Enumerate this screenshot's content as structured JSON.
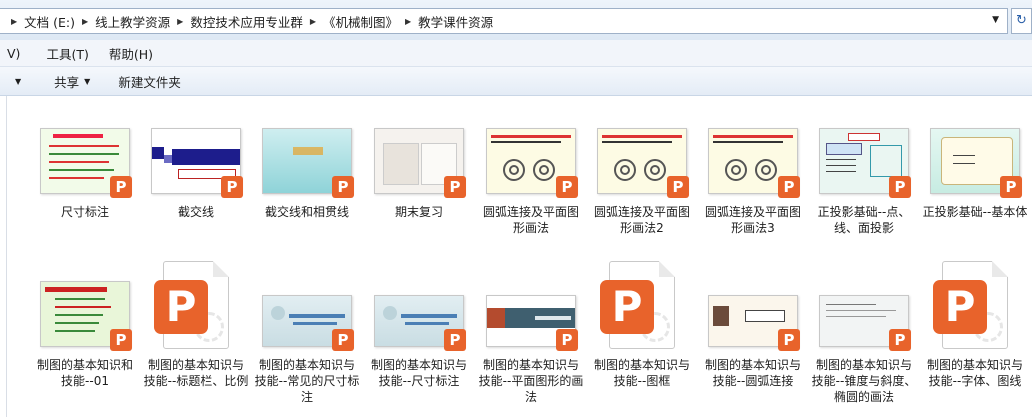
{
  "breadcrumb": {
    "items": [
      "文档 (E:)",
      "线上教学资源",
      "数控技术应用专业群",
      "《机械制图》",
      "教学课件资源"
    ]
  },
  "menubar": {
    "items": [
      "V)",
      "工具(T)",
      "帮助(H)"
    ]
  },
  "toolbar": {
    "share_label": "共享",
    "new_folder_label": "新建文件夹"
  },
  "badge_letter": "P",
  "files": {
    "row1": [
      {
        "label": "尺寸标注"
      },
      {
        "label": "截交线"
      },
      {
        "label": "截交线和相贯线"
      },
      {
        "label": "期末复习"
      },
      {
        "label": "圆弧连接及平面图形画法"
      },
      {
        "label": "圆弧连接及平面图形画法2"
      },
      {
        "label": "圆弧连接及平面图形画法3"
      },
      {
        "label": "正投影基础--点、线、面投影"
      },
      {
        "label": "正投影基础--基本体"
      }
    ],
    "row2": [
      {
        "label": "制图的基本知识和技能--01"
      },
      {
        "label": "制图的基本知识与技能--标题栏、比例"
      },
      {
        "label": "制图的基本知识与技能--常见的尺寸标注"
      },
      {
        "label": "制图的基本知识与技能--尺寸标注"
      },
      {
        "label": "制图的基本知识与技能--平面图形的画法"
      },
      {
        "label": "制图的基本知识与技能--图框"
      },
      {
        "label": "制图的基本知识与技能--圆弧连接"
      },
      {
        "label": "制图的基本知识与技能--锥度与斜度、椭圆的画法"
      },
      {
        "label": "制图的基本知识与技能--字体、图线"
      }
    ]
  },
  "colors": {
    "ppt_orange": "#e8632b",
    "chrome_blue": "#dde8f4"
  }
}
